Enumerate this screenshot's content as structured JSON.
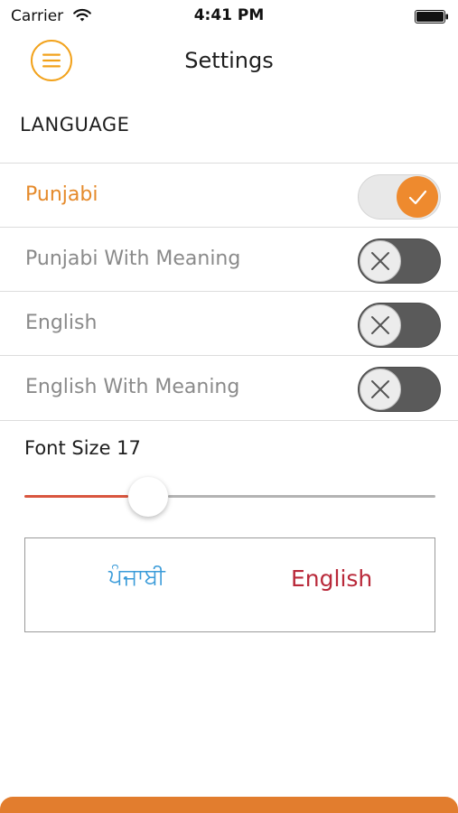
{
  "status_bar": {
    "carrier": "Carrier",
    "time": "4:41 PM",
    "icons": [
      "wifi-icon",
      "battery-icon"
    ]
  },
  "nav": {
    "title": "Settings",
    "menu_icon": "hamburger-menu-icon",
    "accent_color": "#f2a21b"
  },
  "language": {
    "header": "LANGUAGE",
    "options": [
      {
        "label": "Punjabi",
        "enabled": true
      },
      {
        "label": "Punjabi With Meaning",
        "enabled": false
      },
      {
        "label": "English",
        "enabled": false
      },
      {
        "label": "English With Meaning",
        "enabled": false
      }
    ]
  },
  "font_size": {
    "label": "Font Size 17",
    "value": 17,
    "slider_fraction": 0.3
  },
  "preview": {
    "punjabi_text": "ਪੰਜਾਬੀ",
    "english_text": "English",
    "punjabi_color": "#3a9bd9",
    "english_color": "#b9293a"
  },
  "colors": {
    "active_toggle": "#ee8a2e",
    "active_label": "#e58a2b",
    "slider_fill": "#d9563f",
    "bottom_bar": "#e27d2e"
  }
}
